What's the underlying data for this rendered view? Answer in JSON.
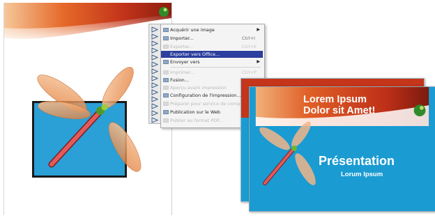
{
  "menu": {
    "items": [
      {
        "label": "Acquérir une image",
        "shortcut": "",
        "arrow": "▶",
        "state": "normal",
        "icon": "scanner-icon"
      },
      {
        "label": "Importer...",
        "shortcut": "Ctrl+I",
        "arrow": "",
        "state": "normal",
        "icon": "import-icon"
      },
      {
        "label": "Exporter...",
        "shortcut": "Ctrl+E",
        "arrow": "",
        "state": "disabled",
        "icon": "export-icon"
      },
      {
        "label": "Exporter vers Office...",
        "shortcut": "",
        "arrow": "",
        "state": "selected",
        "icon": "export-office-icon"
      },
      {
        "label": "Envoyer vers",
        "shortcut": "",
        "arrow": "▶",
        "state": "normal",
        "icon": "send-icon"
      },
      {
        "label": "Imprimer...",
        "shortcut": "Ctrl+P",
        "arrow": "",
        "state": "disabled",
        "icon": "print-icon"
      },
      {
        "label": "Fusion...",
        "shortcut": "",
        "arrow": "",
        "state": "normal",
        "icon": "merge-icon"
      },
      {
        "label": "Aperçu avant impression",
        "shortcut": "",
        "arrow": "",
        "state": "disabled",
        "icon": "preview-icon"
      },
      {
        "label": "Configuration de l'impression...",
        "shortcut": "",
        "arrow": "",
        "state": "normal",
        "icon": "print-setup-icon"
      },
      {
        "label": "Préparer pour service de composition...",
        "shortcut": "",
        "arrow": "",
        "state": "disabled",
        "icon": "prepress-icon"
      },
      {
        "label": "Publication sur le Web",
        "shortcut": "",
        "arrow": "",
        "state": "normal",
        "icon": "web-icon"
      },
      {
        "label": "Publier au format PDF...",
        "shortcut": "",
        "arrow": "",
        "state": "disabled",
        "icon": "pdf-icon"
      }
    ]
  },
  "slide": {
    "title_line1": "Lorem Ipsum",
    "title_line2": "Dolor sit Amet!",
    "heading": "Présentation",
    "subheading": "Lorum Ipsum"
  },
  "colors": {
    "slide_blue": "#1a9bd2",
    "menu_highlight": "#2c3f9e",
    "header_red": "#c4351a",
    "header_orange": "#f08a2b",
    "frame_border": "#1a1a1a"
  },
  "toolbox": {
    "tools": [
      "pick-tool-icon",
      "shape-tool-icon",
      "crop-tool-icon",
      "zoom-tool-icon",
      "freehand-tool-icon",
      "smart-fill-icon",
      "rectangle-tool-icon",
      "ellipse-tool-icon",
      "polygon-tool-icon",
      "text-tool-icon",
      "interactive-tool-icon",
      "eyedropper-icon",
      "outline-tool-icon",
      "fill-tool-icon"
    ]
  }
}
